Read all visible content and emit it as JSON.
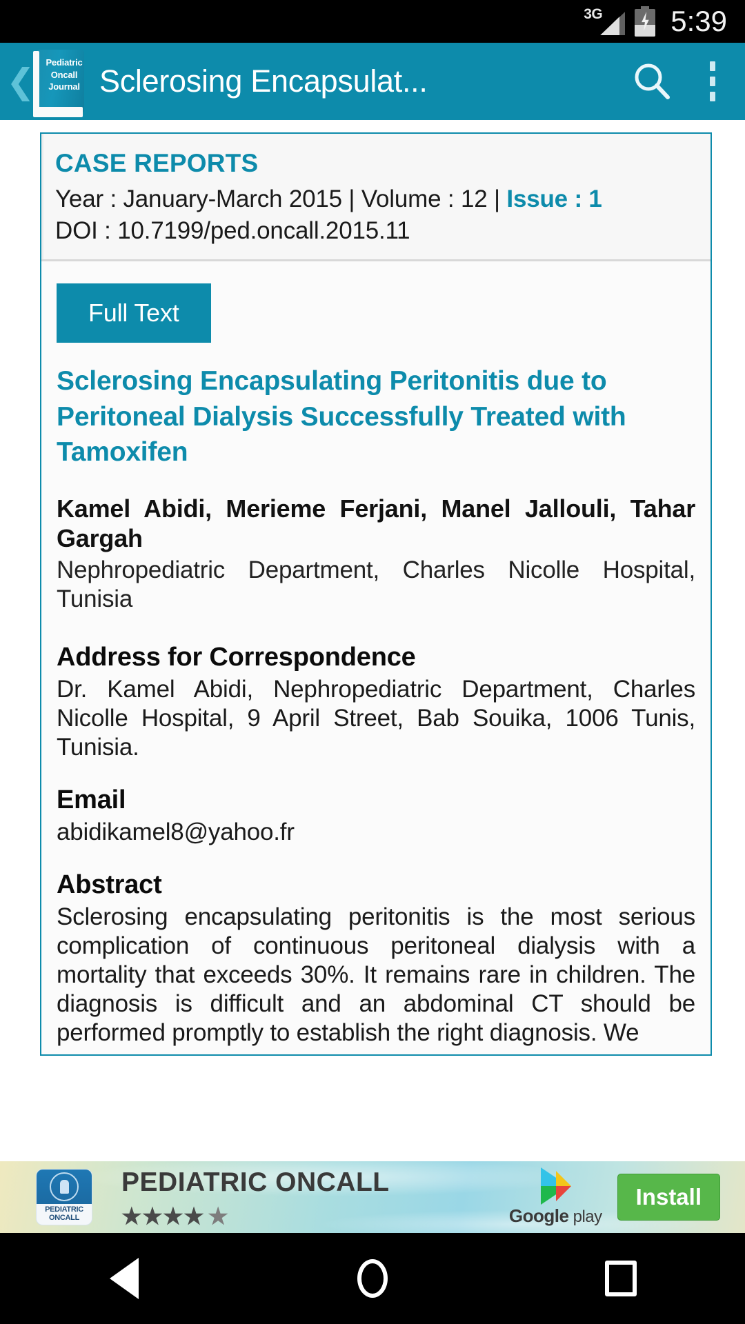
{
  "status_bar": {
    "network": "3G",
    "time": "5:39",
    "battery_icon": "battery-charging-icon",
    "signal_icon": "signal-bars-icon"
  },
  "action_bar": {
    "back_icon": "back-chevron-icon",
    "app_logo_lines": [
      "Pediatric",
      "Oncall",
      "Journal"
    ],
    "title": "Sclerosing Encapsulat...",
    "search_icon": "search-icon",
    "overflow_icon": "overflow-menu-icon",
    "background_color": "#0d8bab"
  },
  "article": {
    "kicker": "CASE REPORTS",
    "meta_prefix": "Year : January-March 2015 | Volume : 12 | ",
    "meta_issue": "Issue : 1",
    "doi_line": "DOI : 10.7199/ped.oncall.2015.11",
    "full_text_label": "Full Text",
    "title": "Sclerosing Encapsulating Peritonitis due to Peritoneal Dialysis Successfully Treated with Tamoxifen",
    "authors": "Kamel Abidi, Merieme Ferjani, Manel Jallouli, Tahar Gargah",
    "affiliation": "Nephropediatric Department, Charles Nicolle Hospital, Tunisia",
    "correspondence_heading": "Address for Correspondence",
    "correspondence_body": "Dr. Kamel Abidi, Nephropediatric Department, Charles Nicolle Hospital, 9 April Street, Bab Souika, 1006 Tunis, Tunisia.",
    "email_heading": "Email",
    "email_value": "abidikamel8@yahoo.fr",
    "abstract_heading": "Abstract",
    "abstract_body": "Sclerosing encapsulating peritonitis is the most serious complication of continuous peritoneal dialysis with a mortality that exceeds 30%. It remains rare in children. The diagnosis is difficult and an abdominal CT should be performed promptly to establish the right diagnosis. We",
    "accent_color": "#0d8bab"
  },
  "ad_banner": {
    "icon_label_line1": "PEDIATRIC",
    "icon_label_line2": "ONCALL",
    "title": "PEDIATRIC ONCALL",
    "rating_stars": "★★★★",
    "rating_half_star": "★",
    "store_brand": "Google",
    "store_brand_suffix": "play",
    "install_label": "Install",
    "install_color": "#57b74a"
  },
  "nav_bar": {
    "back_icon": "nav-back-triangle-icon",
    "home_icon": "nav-home-circle-icon",
    "recents_icon": "nav-recents-square-icon"
  }
}
